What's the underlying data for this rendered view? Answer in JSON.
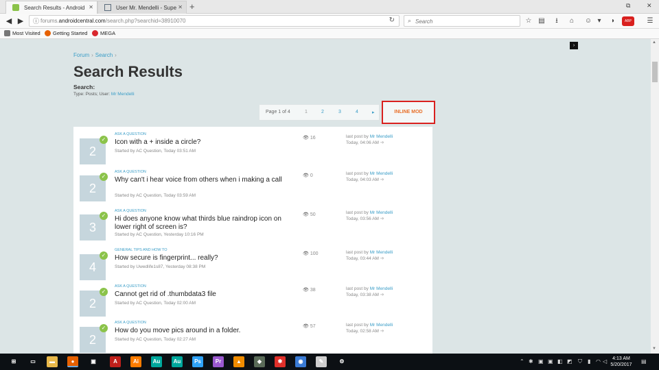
{
  "browser": {
    "tabs": [
      {
        "title": "Search Results - Android Fo",
        "active": true,
        "favicon_color": "#8bc34a"
      },
      {
        "title": "User Mr. Mendelli - Super U",
        "active": false,
        "favicon_color": "#5a6b7b"
      }
    ],
    "new_tab_label": "+",
    "url_prefix": "forums.",
    "url_domain": "androidcentral.com",
    "url_path": "/search.php?searchid=38910070",
    "search_placeholder": "Search",
    "bookmarks": [
      {
        "label": "Most Visited",
        "icon_color": "#555"
      },
      {
        "label": "Getting Started",
        "icon_color": "#e66000"
      },
      {
        "label": "MEGA",
        "icon_color": "#d9272e"
      }
    ],
    "adblock_badge": "ABP"
  },
  "page": {
    "breadcrumb": [
      "Forum",
      "Search"
    ],
    "title": "Search Results",
    "search_label": "Search:",
    "search_type_prefix": "Type: Posts; User:",
    "search_user": "Mr Mendelli",
    "pager": {
      "label": "Page 1 of 4",
      "pages": [
        "1",
        "2",
        "3",
        "4"
      ],
      "next": "▸"
    },
    "inline_mod": "INLINE MOD",
    "threads": [
      {
        "replies": "2",
        "forum": "ASK A QUESTION",
        "title": "Icon with a + inside a circle?",
        "started": "Started by AC Question, Today 03:51 AM",
        "views": "16",
        "last_by": "Mr Mendelli",
        "last_time": "Today, 04:06 AM"
      },
      {
        "replies": "2",
        "forum": "ASK A QUESTION",
        "title": "Why can't i hear voice from others when i making a call",
        "started": "Started by AC Question, Today 03:59 AM",
        "views": "0",
        "last_by": "Mr Mendelli",
        "last_time": "Today, 04:03 AM"
      },
      {
        "replies": "3",
        "forum": "ASK A QUESTION",
        "title": "Hi does anyone know what thirds blue raindrop icon on lower right of screen is?",
        "started": "Started by AC Question, Yesterday 10:16 PM",
        "views": "50",
        "last_by": "Mr Mendelli",
        "last_time": "Today, 03:56 AM"
      },
      {
        "replies": "4",
        "forum": "GENERAL TIPS AND HOW TO",
        "title": "How secure is fingerprint... really?",
        "started": "Started by Uwedlife1s87, Yesterday 08:38 PM",
        "views": "100",
        "last_by": "Mr Mendelli",
        "last_time": "Today, 03:44 AM"
      },
      {
        "replies": "2",
        "forum": "ASK A QUESTION",
        "title": "Cannot get rid of .thumbdata3 file",
        "started": "Started by AC Question, Today 02:00 AM",
        "views": "38",
        "last_by": "Mr Mendelli",
        "last_time": "Today, 03:38 AM"
      },
      {
        "replies": "2",
        "forum": "ASK A QUESTION",
        "title": "How do you move pics around in a folder.",
        "started": "Started by AC Question, Today 02:27 AM",
        "views": "57",
        "last_by": "Mr Mendelli",
        "last_time": "Today, 02:58 AM"
      }
    ],
    "last_post_prefix": "last post by"
  },
  "taskbar": {
    "apps": [
      {
        "name": "start",
        "glyph": "⊞",
        "color": "transparent"
      },
      {
        "name": "task-view",
        "glyph": "▭",
        "color": "transparent"
      },
      {
        "name": "file-explorer",
        "glyph": "▬",
        "color": "#e8b84a"
      },
      {
        "name": "firefox",
        "glyph": "●",
        "color": "#e66000"
      },
      {
        "name": "store",
        "glyph": "▣",
        "color": "transparent"
      },
      {
        "name": "acrobat",
        "glyph": "A",
        "color": "#c0201b"
      },
      {
        "name": "illustrator",
        "glyph": "Ai",
        "color": "#ff7c00"
      },
      {
        "name": "audition",
        "glyph": "Au",
        "color": "#00a89d"
      },
      {
        "name": "audition-2",
        "glyph": "Au",
        "color": "#00a89d"
      },
      {
        "name": "photoshop",
        "glyph": "Ps",
        "color": "#2fa3f7"
      },
      {
        "name": "premiere",
        "glyph": "Pr",
        "color": "#9b59d0"
      },
      {
        "name": "vlc",
        "glyph": "▲",
        "color": "#f08c00"
      },
      {
        "name": "app-3d",
        "glyph": "◆",
        "color": "#5a6b58"
      },
      {
        "name": "app-star",
        "glyph": "✱",
        "color": "#e0302a"
      },
      {
        "name": "chat",
        "glyph": "◉",
        "color": "#3a7bd5"
      },
      {
        "name": "notes",
        "glyph": "✎",
        "color": "#cfcfcf"
      },
      {
        "name": "settings",
        "glyph": "⚙",
        "color": "transparent"
      }
    ],
    "time": "4:13 AM",
    "date": "5/20/2017"
  },
  "colors": {
    "accent_link": "#3a9dc7",
    "inline_mod_border": "#d9201e",
    "inline_mod_text": "#e8702a",
    "check_green": "#8bc34a"
  }
}
